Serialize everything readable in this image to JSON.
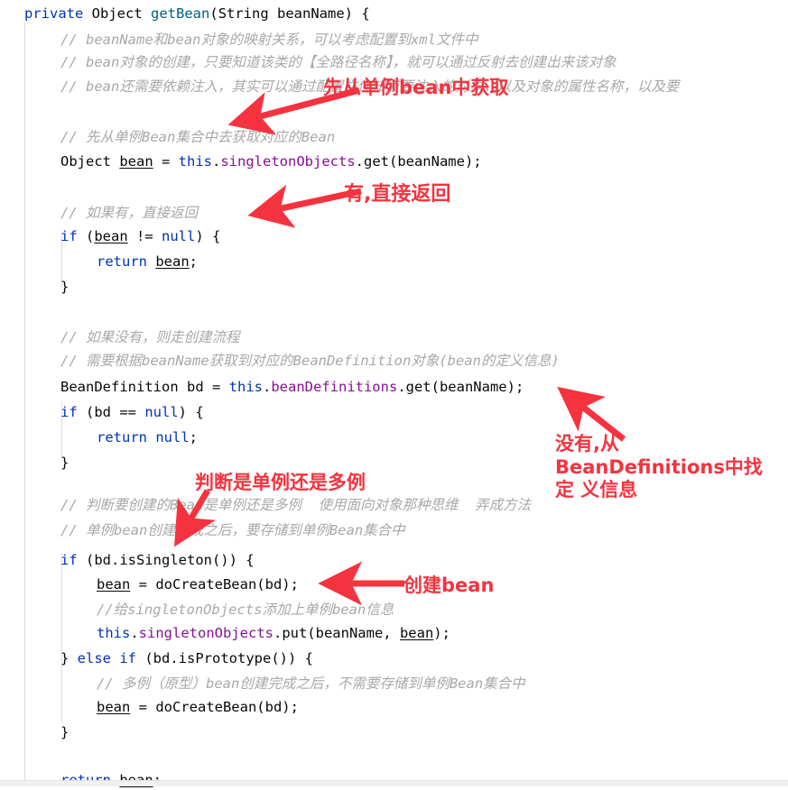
{
  "editor": {
    "language": "java",
    "background": "#ffffff",
    "colors": {
      "keyword": "#0033b3",
      "method": "#00627a",
      "field": "#871094",
      "comment": "#a8a8a8",
      "text": "#080808",
      "annotation_red": "#f5333f",
      "indent_guide": "#d8d8d8"
    }
  },
  "code": {
    "lines": [
      {
        "id": "l1",
        "indent": 0,
        "text": "private Object getBean(String beanName) {"
      },
      {
        "id": "l2",
        "indent": 1,
        "text": "// beanName和bean对象的映射关系，可以考虑配置到xml文件中"
      },
      {
        "id": "l3",
        "indent": 1,
        "text": "// bean对象的创建，只要知道该类的【全路径名称】，就可以通过反射去创建出来该对象"
      },
      {
        "id": "l4",
        "indent": 1,
        "text": "// bean还需要依赖注入，其实可以通过配置文件知道要注入的对象，以及对象的属性名称，以及要"
      },
      {
        "id": "l5",
        "indent": 0,
        "text": ""
      },
      {
        "id": "l6",
        "indent": 1,
        "text": "// 先从单例Bean集合中去获取对应的Bean"
      },
      {
        "id": "l7",
        "indent": 1,
        "text": "Object bean = this.singletonObjects.get(beanName);"
      },
      {
        "id": "l8",
        "indent": 0,
        "text": ""
      },
      {
        "id": "l9",
        "indent": 1,
        "text": "// 如果有，直接返回"
      },
      {
        "id": "l10",
        "indent": 1,
        "text": "if (bean != null) {"
      },
      {
        "id": "l11",
        "indent": 2,
        "text": "return bean;"
      },
      {
        "id": "l12",
        "indent": 1,
        "text": "}"
      },
      {
        "id": "l13",
        "indent": 0,
        "text": ""
      },
      {
        "id": "l14",
        "indent": 0,
        "text": ""
      },
      {
        "id": "l15",
        "indent": 1,
        "text": "// 如果没有，则走创建流程"
      },
      {
        "id": "l16",
        "indent": 1,
        "text": "// 需要根据beanName获取到对应的BeanDefinition对象(bean的定义信息)"
      },
      {
        "id": "l17",
        "indent": 1,
        "text": "BeanDefinition bd = this.beanDefinitions.get(beanName);"
      },
      {
        "id": "l18",
        "indent": 1,
        "text": "if (bd == null) {"
      },
      {
        "id": "l19",
        "indent": 2,
        "text": "return null;"
      },
      {
        "id": "l20",
        "indent": 1,
        "text": "}"
      },
      {
        "id": "l21",
        "indent": 0,
        "text": ""
      },
      {
        "id": "l22",
        "indent": 1,
        "text": "// 判断要创建的Bean是单例还是多例  使用面向对象那种思维  弄成方法"
      },
      {
        "id": "l23",
        "indent": 1,
        "text": "// 单例bean创建完成之后，要存储到单例Bean集合中"
      },
      {
        "id": "l24",
        "indent": 1,
        "text": "if (bd.isSingleton()) {"
      },
      {
        "id": "l25",
        "indent": 2,
        "text": "bean = doCreateBean(bd);"
      },
      {
        "id": "l26",
        "indent": 2,
        "text": "//给singletonObjects添加上单例bean信息"
      },
      {
        "id": "l27",
        "indent": 2,
        "text": "this.singletonObjects.put(beanName, bean);"
      },
      {
        "id": "l28",
        "indent": 1,
        "text": "} else if (bd.isPrototype()) {"
      },
      {
        "id": "l29",
        "indent": 2,
        "text": "// 多例（原型）bean创建完成之后，不需要存储到单例Bean集合中"
      },
      {
        "id": "l30",
        "indent": 2,
        "text": "bean = doCreateBean(bd);"
      },
      {
        "id": "l31",
        "indent": 1,
        "text": "}"
      },
      {
        "id": "l32",
        "indent": 0,
        "text": ""
      },
      {
        "id": "l33",
        "indent": 0,
        "text": ""
      },
      {
        "id": "l34",
        "indent": 1,
        "text": "return bean;"
      }
    ]
  },
  "annotations": [
    {
      "id": "a1",
      "text": "先从单例bean中获取",
      "color": "#f5333f"
    },
    {
      "id": "a2",
      "text": "有,直接返回",
      "color": "#f5333f"
    },
    {
      "id": "a3",
      "text": "没有,从\nBeanDefinitions中找定\n义信息",
      "color": "#f5333f"
    },
    {
      "id": "a4",
      "text": "判断是单例还是多例",
      "color": "#f5333f"
    },
    {
      "id": "a5",
      "text": "创建bean",
      "color": "#f5333f"
    }
  ]
}
